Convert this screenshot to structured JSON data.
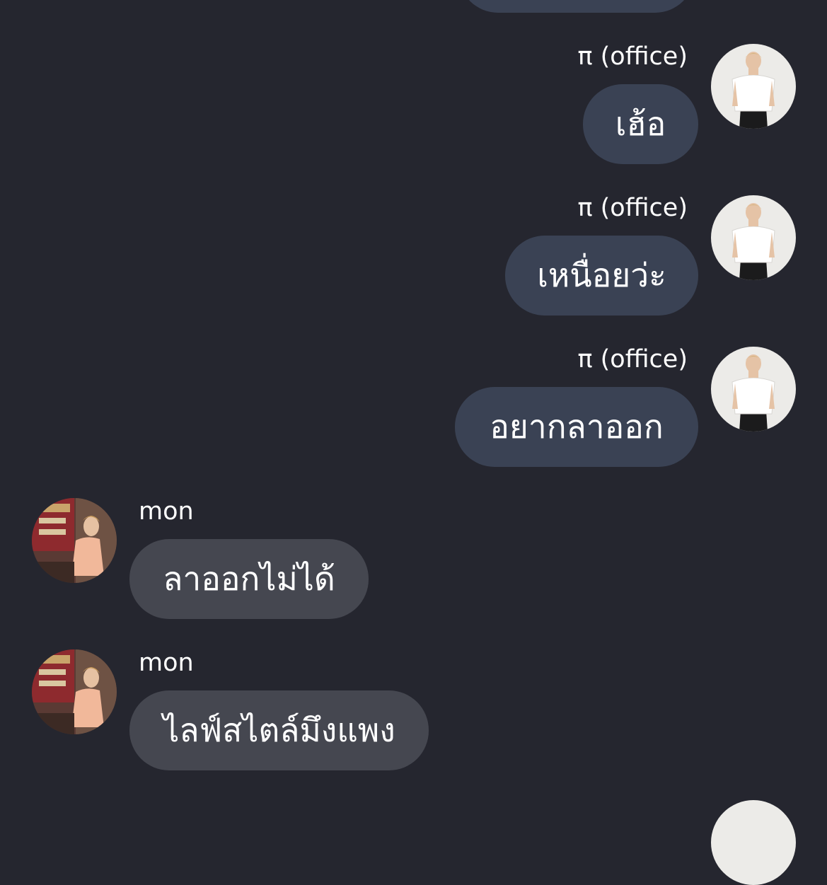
{
  "conversation": {
    "messages": [
      {
        "sender": "π (office)",
        "text": "เฮ้อ",
        "direction": "outgoing"
      },
      {
        "sender": "π (office)",
        "text": "เหนื่อยว่ะ",
        "direction": "outgoing"
      },
      {
        "sender": "π (office)",
        "text": "อยากลาออก",
        "direction": "outgoing"
      },
      {
        "sender": "mon",
        "text": "ลาออกไม่ได้",
        "direction": "incoming"
      },
      {
        "sender": "mon",
        "text": "ไลฟ์สไตล์มึงแพง",
        "direction": "incoming"
      }
    ]
  },
  "colors": {
    "background": "#25262f",
    "outgoing_bubble": "#3a4254",
    "incoming_bubble": "#454750",
    "text": "#ffffff"
  },
  "icons": {
    "outgoing_avatar": "avatar-photo-person-white-shirt",
    "incoming_avatar": "avatar-photo-person-peach-jacket"
  }
}
